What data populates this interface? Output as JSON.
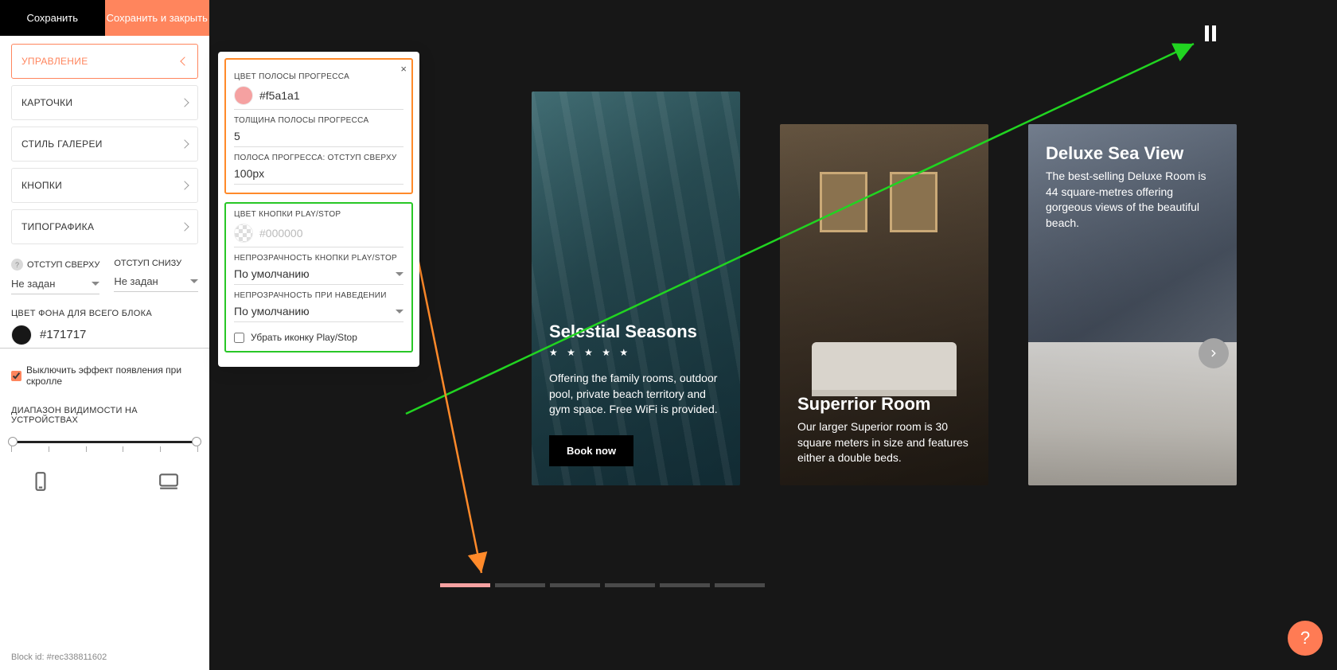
{
  "topbar": {
    "save": "Сохранить",
    "save_close": "Сохранить и закрыть"
  },
  "accordion": [
    {
      "label": "УПРАВЛЕНИЕ",
      "active": true
    },
    {
      "label": "КАРТОЧКИ"
    },
    {
      "label": "СТИЛЬ ГАЛЕРЕИ"
    },
    {
      "label": "КНОПКИ"
    },
    {
      "label": "ТИПОГРАФИКА"
    }
  ],
  "offsets": {
    "top_label": "ОТСТУП СВЕРХУ",
    "bottom_label": "ОТСТУП СНИЗУ",
    "top_val": "Не задан",
    "bottom_val": "Не задан"
  },
  "bgcolor": {
    "label": "ЦВЕТ ФОНА ДЛЯ ВСЕГО БЛОКА",
    "value": "#171717"
  },
  "scroll_fx": {
    "label": "Выключить эффект появления при скролле",
    "checked": true
  },
  "visibility": {
    "label": "ДИАПАЗОН ВИДИМОСТИ НА УСТРОЙСТВАХ"
  },
  "block_id": "Block id: #rec338811602",
  "panel": {
    "progress_color": {
      "label": "ЦВЕТ ПОЛОСЫ ПРОГРЕССА",
      "value": "#f5a1a1"
    },
    "progress_thickness": {
      "label": "ТОЛЩИНА ПОЛОСЫ ПРОГРЕССА",
      "value": "5"
    },
    "progress_offset": {
      "label": "ПОЛОСА ПРОГРЕССА: ОТСТУП СВЕРХУ",
      "placeholder": "100px"
    },
    "play_color": {
      "label": "ЦВЕТ КНОПКИ PLAY/STOP",
      "placeholder": "#000000"
    },
    "play_opacity": {
      "label": "НЕПРОЗРАЧНОСТЬ КНОПКИ PLAY/STOP",
      "value": "По умолчанию"
    },
    "play_hover": {
      "label": "НЕПРОЗРАЧНОСТЬ ПРИ НАВЕДЕНИИ",
      "value": "По умолчанию"
    },
    "hide_icon": {
      "label": "Убрать иконку Play/Stop",
      "checked": false
    }
  },
  "cards": [
    {
      "title": "Selestial Seasons",
      "stars": "★ ★ ★ ★ ★",
      "desc": "Offering the family rooms, outdoor pool, private beach territory and gym space. Free WiFi is provided.",
      "cta": "Book now"
    },
    {
      "title": "Superrior Room",
      "desc": "Our larger Superior room is 30 square meters in size and features either a double beds."
    },
    {
      "title": "Deluxe Sea View",
      "desc": "The best-selling Deluxe Room is 44 square-metres offering gorgeous views of the beautiful beach."
    }
  ],
  "help": "?",
  "annotations": {
    "green": {
      "color": "#21d421"
    },
    "orange": {
      "color": "#ff8a2a"
    }
  },
  "chart_data": {
    "type": "bar",
    "note": "progress indicator segments at bottom of gallery",
    "categories": [
      "1",
      "2",
      "3",
      "4",
      "5",
      "6"
    ],
    "values": [
      1,
      0,
      0,
      0,
      0,
      0
    ],
    "active_color": "#f5a1a1",
    "inactive_color": "#4a4a4a",
    "thickness_px": 5
  }
}
